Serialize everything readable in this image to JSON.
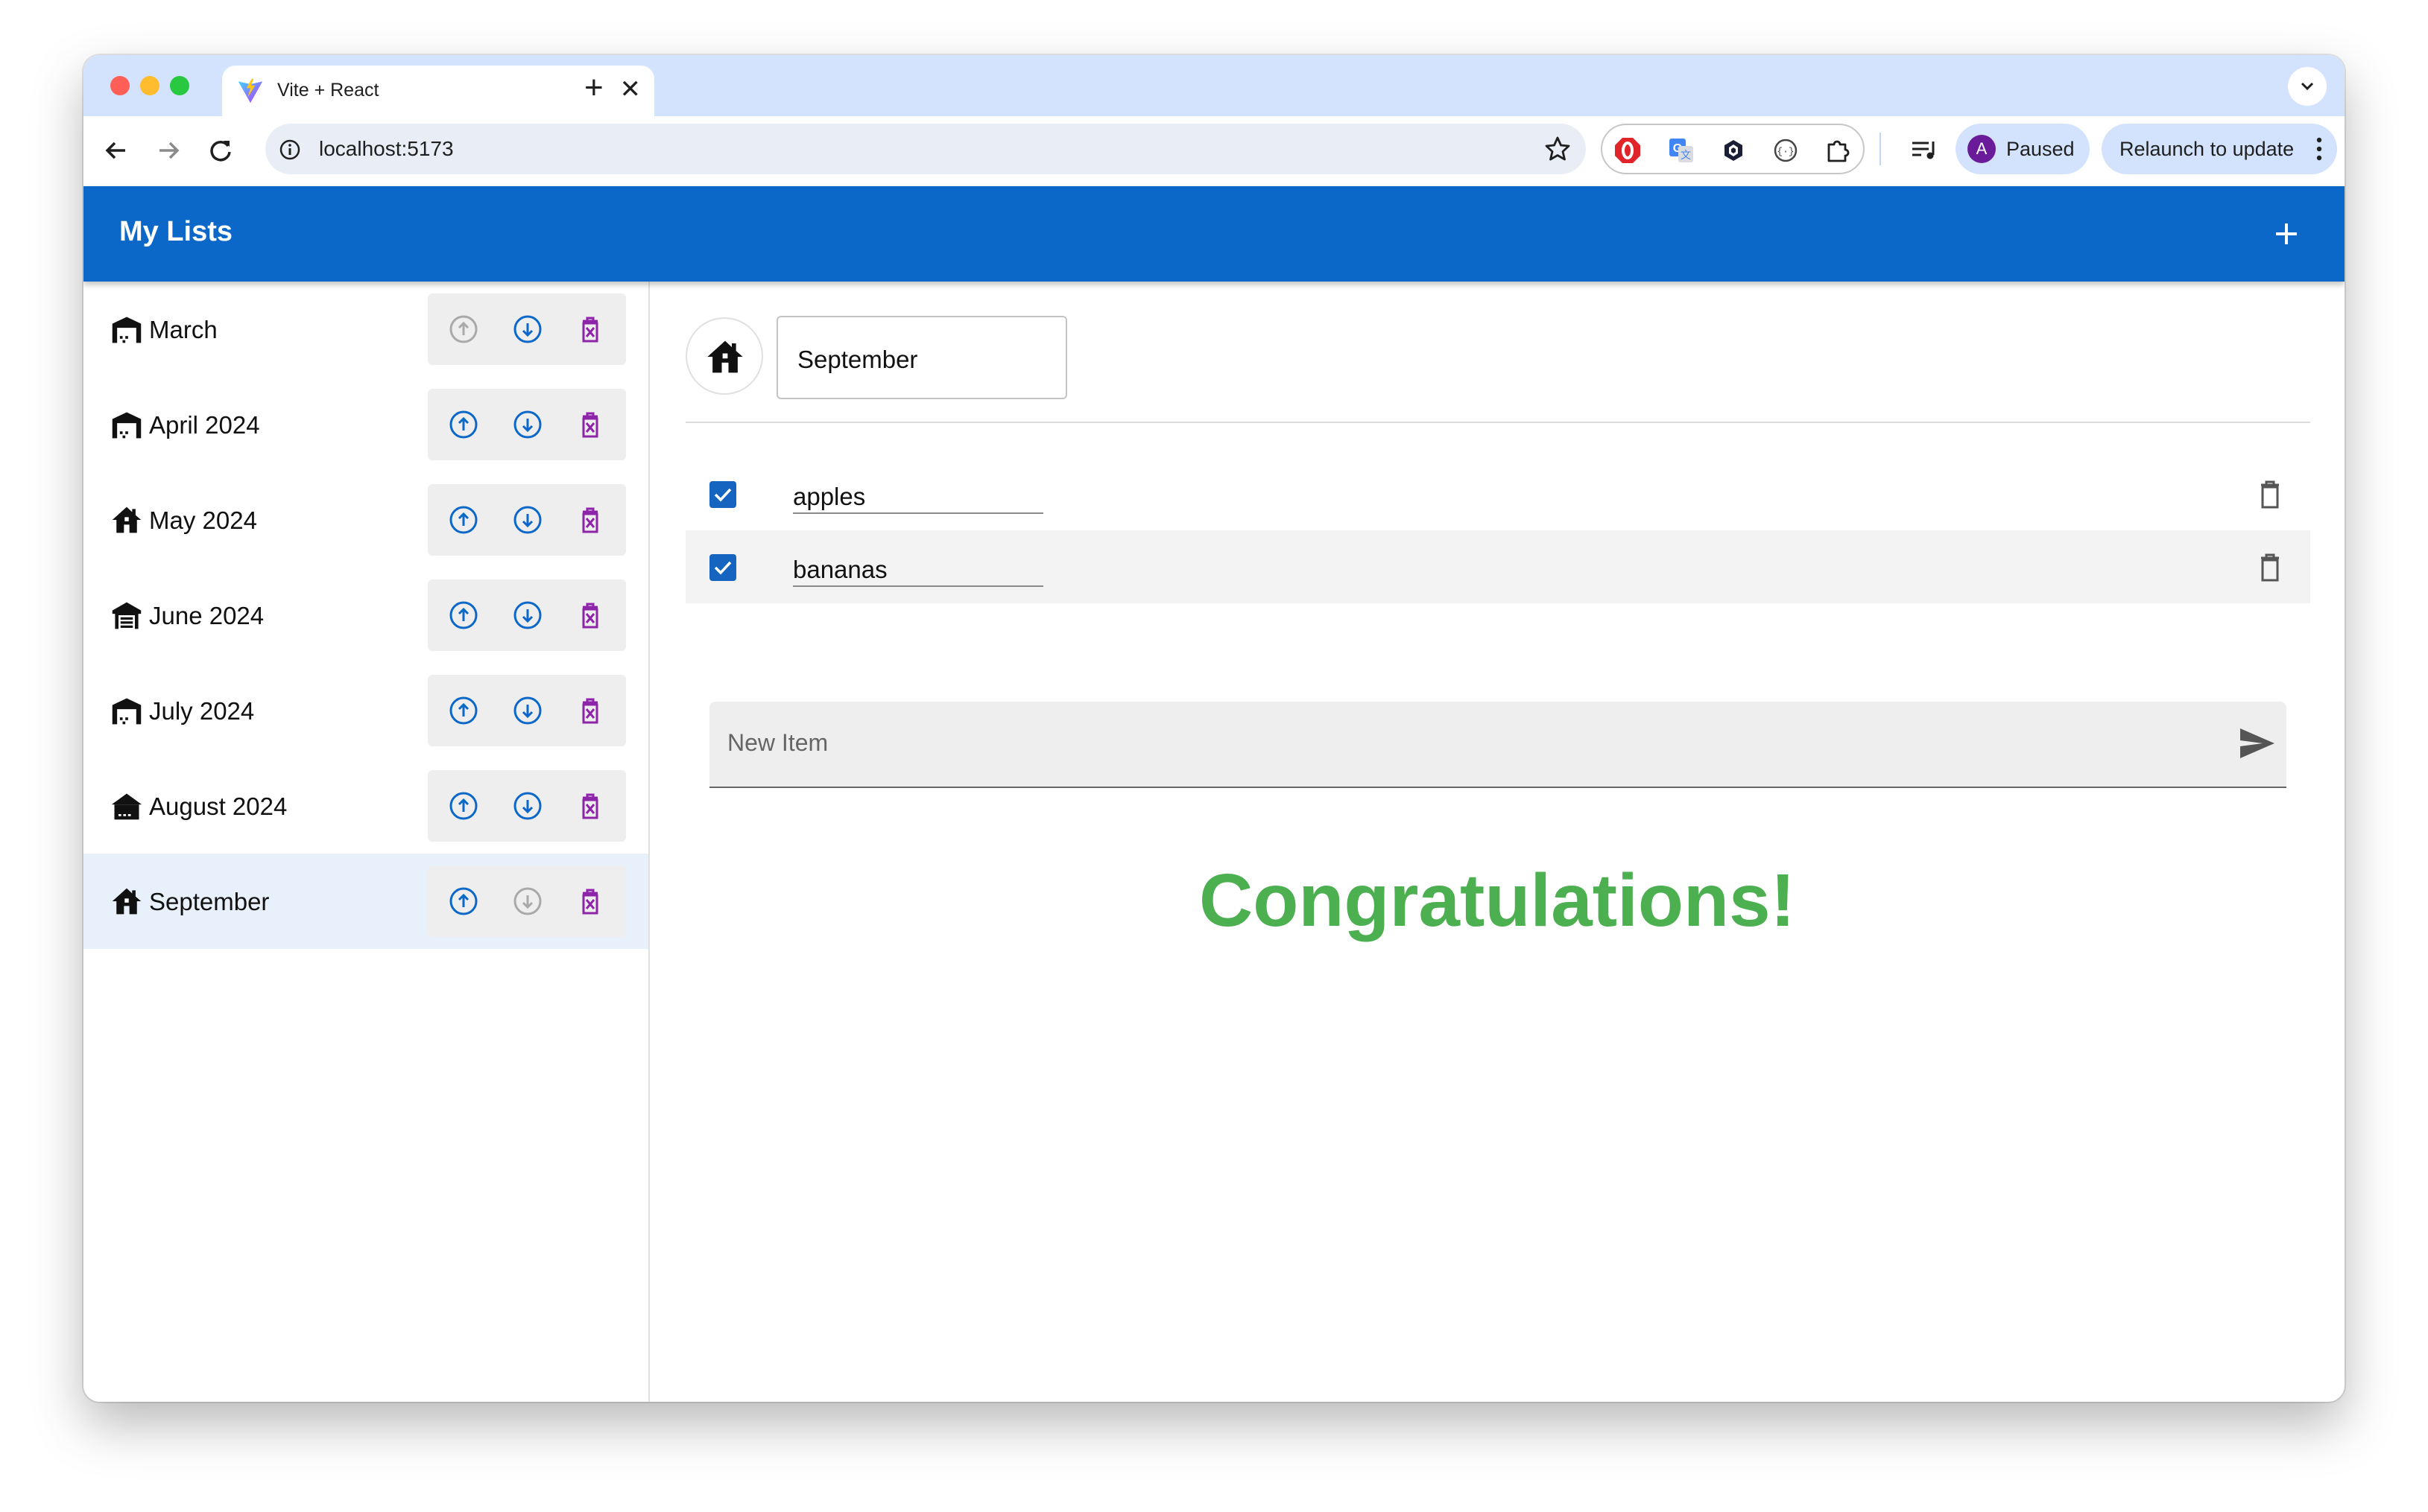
{
  "browser": {
    "tab_title": "Vite + React",
    "url": "localhost:5173",
    "profile_initial": "A",
    "profile_status": "Paused",
    "relaunch_label": "Relaunch to update"
  },
  "app": {
    "title": "My Lists",
    "accent_color": "#0b68c9"
  },
  "lists": [
    {
      "label": "March",
      "icon": "warehouse-icon",
      "move_up_enabled": false,
      "move_down_enabled": true
    },
    {
      "label": "April 2024",
      "icon": "warehouse-icon",
      "move_up_enabled": true,
      "move_down_enabled": true
    },
    {
      "label": "May 2024",
      "icon": "house-icon",
      "move_up_enabled": true,
      "move_down_enabled": true
    },
    {
      "label": "June 2024",
      "icon": "garage-icon",
      "move_up_enabled": true,
      "move_down_enabled": true
    },
    {
      "label": "July 2024",
      "icon": "warehouse-icon",
      "move_up_enabled": true,
      "move_down_enabled": true
    },
    {
      "label": "August 2024",
      "icon": "store-icon",
      "move_up_enabled": true,
      "move_down_enabled": true
    },
    {
      "label": "September",
      "icon": "house-icon",
      "move_up_enabled": true,
      "move_down_enabled": false,
      "selected": true
    }
  ],
  "selected_list": {
    "name": "September",
    "icon": "house-icon",
    "items": [
      {
        "label": "apples",
        "checked": true
      },
      {
        "label": "bananas",
        "checked": true
      }
    ],
    "new_item_placeholder": "New Item",
    "completion_message": "Congratulations!",
    "completion_color": "#4caf50"
  }
}
